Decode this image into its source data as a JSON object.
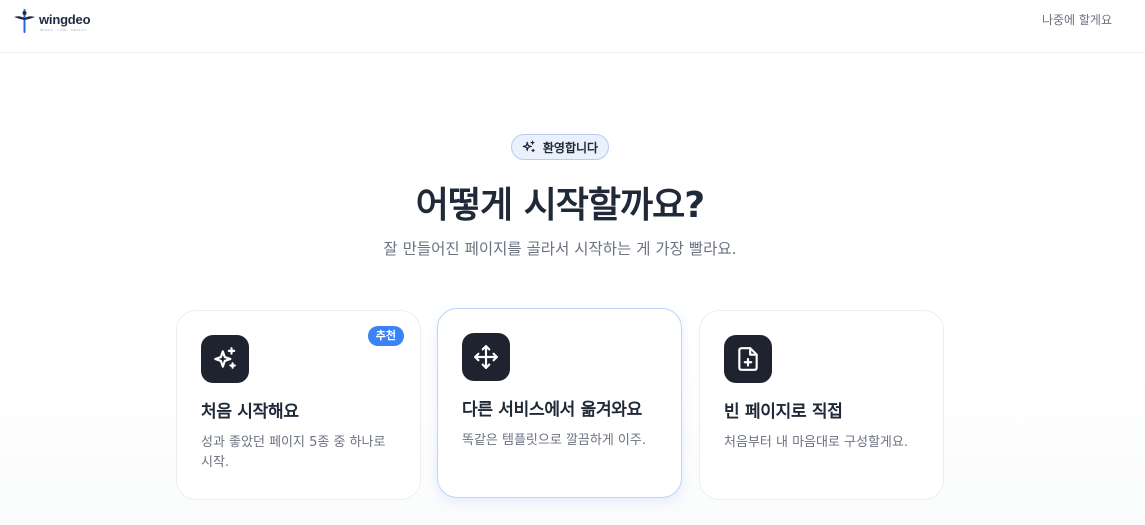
{
  "header": {
    "logo_text": "wingdeo",
    "logo_tagline": "WINGS · LINK · DEPLOY",
    "later_link": "나중에 할게요"
  },
  "hero": {
    "badge": "환영합니다",
    "title": "어떻게 시작할까요?",
    "subtitle": "잘 만들어진 페이지를 골라서 시작하는 게 가장 빨라요."
  },
  "cards": [
    {
      "icon": "sparkles-icon",
      "title": "처음 시작해요",
      "desc": "성과 좋았던 페이지 5종 중 하나로 시작.",
      "badge": "추천"
    },
    {
      "icon": "move-arrows-icon",
      "title": "다른 서비스에서 옮겨와요",
      "desc": "똑같은 템플릿으로 깔끔하게 이주."
    },
    {
      "icon": "file-plus-icon",
      "title": "빈 페이지로 직접",
      "desc": "처음부터 내 마음대로 구성할게요."
    }
  ],
  "colors": {
    "accent": "#3b82f6",
    "icon_bg": "#1f2330",
    "badge_bg": "#eaf1fc"
  }
}
